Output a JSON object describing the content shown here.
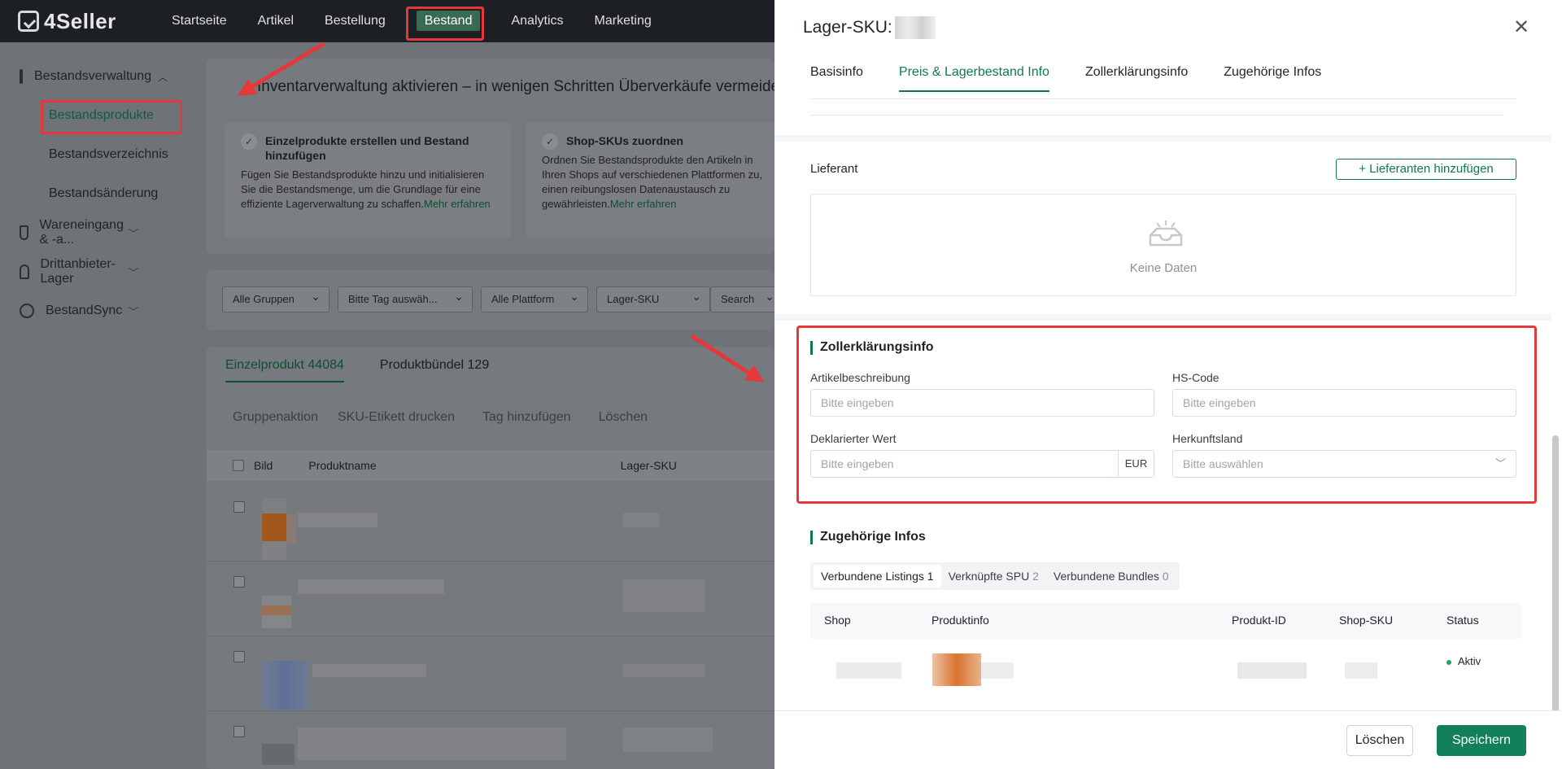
{
  "brand": {
    "name": "4Seller"
  },
  "topnav": {
    "items": [
      {
        "label": "Startseite"
      },
      {
        "label": "Artikel"
      },
      {
        "label": "Bestellung"
      },
      {
        "label": "Bestand"
      },
      {
        "label": "Analytics"
      },
      {
        "label": "Marketing"
      }
    ],
    "active": "Bestand"
  },
  "sidebar": {
    "groups": [
      {
        "label": "Bestandsverwaltung",
        "icon": "box-icon",
        "expanded": true
      },
      {
        "label": "Wareneingang & -a...",
        "icon": "inbound-icon"
      },
      {
        "label": "Drittanbieter-Lager",
        "icon": "warehouse-icon"
      },
      {
        "label": "BestandSync",
        "icon": "sync-icon"
      }
    ],
    "subitems": [
      {
        "label": "Bestandsprodukte",
        "active": true
      },
      {
        "label": "Bestandsverzeichnis"
      },
      {
        "label": "Bestandsänderung"
      }
    ]
  },
  "main": {
    "banner_title": "Inventarverwaltung aktivieren – in wenigen Schritten Überverkäufe vermeiden",
    "steps": [
      {
        "title": "Einzelprodukte erstellen und Bestand hinzufügen",
        "desc": "Fügen Sie Bestandsprodukte hinzu und initialisieren Sie die Bestandsmenge, um die Grundlage für eine effiziente Lagerverwaltung zu schaffen.",
        "more": "Mehr erfahren"
      },
      {
        "title": "Shop-SKUs zuordnen",
        "desc": "Ordnen Sie Bestandsprodukte den Artikeln in Ihren Shops auf verschiedenen Plattformen zu, einen reibungslosen Datenaustausch zu gewährleisten.",
        "more": "Mehr erfahren"
      }
    ],
    "filters": [
      {
        "label": "Alle Gruppen"
      },
      {
        "label": "Bitte Tag auswäh..."
      },
      {
        "label": "Alle Plattform"
      },
      {
        "label": "Lager-SKU"
      },
      {
        "label": "Search"
      }
    ],
    "tabs": [
      {
        "label": "Einzelprodukt 44084"
      },
      {
        "label": "Produktbündel 129"
      }
    ],
    "actions": [
      {
        "label": "Gruppenaktion"
      },
      {
        "label": "SKU-Etikett drucken"
      },
      {
        "label": "Tag hinzufügen"
      },
      {
        "label": "Löschen"
      }
    ],
    "table_headers": [
      "Bild",
      "Produktname",
      "Lager-SKU"
    ]
  },
  "drawer": {
    "title": "Lager-SKU:",
    "tabs": [
      {
        "label": "Basisinfo"
      },
      {
        "label": "Preis & Lagerbestand Info",
        "active": true
      },
      {
        "label": "Zollerklärungsinfo"
      },
      {
        "label": "Zugehörige Infos"
      }
    ],
    "supplier": {
      "label": "Lieferant",
      "add_button": "+ Lieferanten hinzufügen",
      "empty_text": "Keine Daten"
    },
    "customs": {
      "title": "Zollerklärungsinfo",
      "fields": {
        "description": {
          "label": "Artikelbeschreibung",
          "placeholder": "Bitte eingeben"
        },
        "hs_code": {
          "label": "HS-Code",
          "placeholder": "Bitte eingeben"
        },
        "declared_value": {
          "label": "Deklarierter Wert",
          "placeholder": "Bitte eingeben",
          "currency": "EUR"
        },
        "origin": {
          "label": "Herkunftsland",
          "placeholder": "Bitte auswählen"
        }
      }
    },
    "related": {
      "title": "Zugehörige Infos",
      "subtabs": [
        {
          "label": "Verbundene Listings",
          "count": "1",
          "active": true
        },
        {
          "label": "Verknüpfte SPU",
          "count": "2"
        },
        {
          "label": "Verbundene Bundles",
          "count": "0"
        }
      ],
      "columns": [
        "Shop",
        "Produktinfo",
        "Produkt-ID",
        "Shop-SKU",
        "Status"
      ],
      "rows": [
        {
          "status": "Aktiv"
        }
      ]
    },
    "footer": {
      "delete_label": "Löschen",
      "save_label": "Speichern"
    }
  },
  "colors": {
    "accent": "#0e7a4d",
    "highlight": "#e5383b",
    "topbar": "#1c1f23"
  }
}
